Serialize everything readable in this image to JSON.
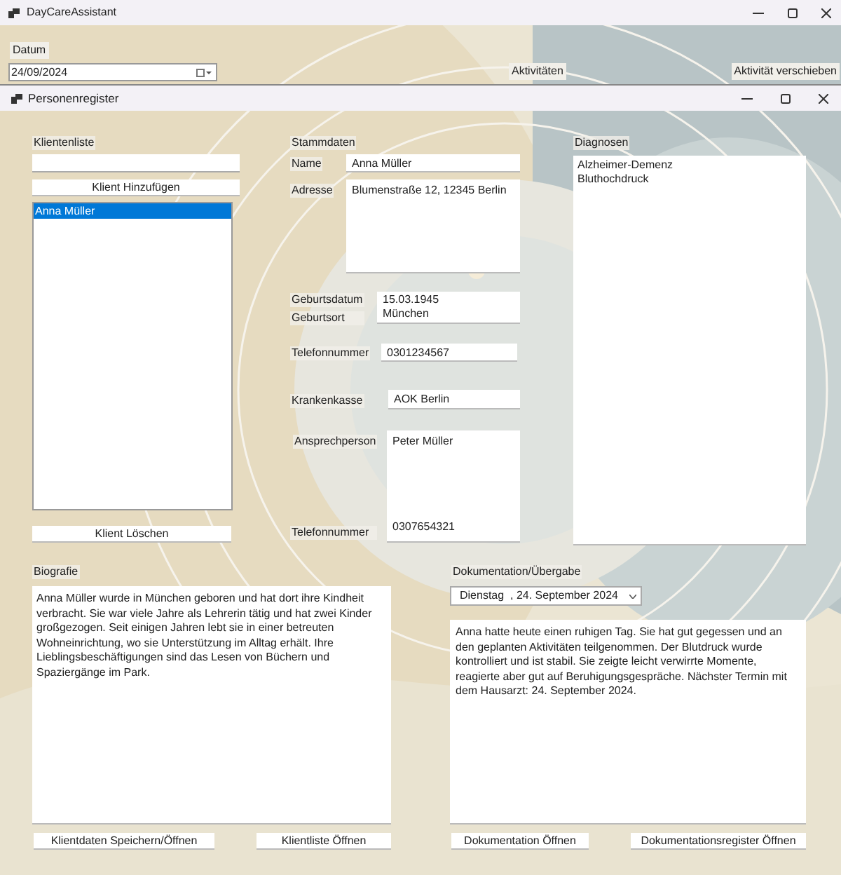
{
  "main_window": {
    "title": "DayCareAssistant"
  },
  "date": {
    "label": "Datum",
    "value": "24/09/2024"
  },
  "toolbar_labels": [
    "Aktivitäten",
    "Aktivität verschieben"
  ],
  "register_window": {
    "title": "Personenregister"
  },
  "client_list": {
    "label": "Klientenliste",
    "add_button": "Klient Hinzufügen",
    "items": [
      {
        "label": "Anna Müller",
        "selected": true
      }
    ],
    "delete_button": "Klient Löschen"
  },
  "master_data": {
    "label": "Stammdaten",
    "name": {
      "label": "Name",
      "value": "Anna Müller"
    },
    "address": {
      "label": "Adresse",
      "value": "Blumenstraße 12, 12345 Berlin"
    },
    "birth": {
      "label_date": "Geburtsdatum",
      "label_place": "Geburtsort",
      "date": "15.03.1945",
      "place": "München"
    },
    "phone": {
      "label": "Telefonnummer",
      "value": "0301234567"
    },
    "insurance": {
      "label": "Krankenkasse",
      "value": "AOK Berlin"
    },
    "contact": {
      "label": "Ansprechperson",
      "value": "Peter Müller",
      "phone_label": "Telefonnummer",
      "phone": "0307654321"
    }
  },
  "diagnoses": {
    "label": "Diagnosen",
    "items": [
      "Alzheimer-Demenz",
      "Bluthochdruck"
    ]
  },
  "biography": {
    "label": "Biografie",
    "text": "Anna Müller wurde in München geboren und hat dort ihre Kindheit verbracht. Sie war viele Jahre als Lehrerin tätig und hat zwei Kinder großgezogen. Seit einigen Jahren lebt sie in einer betreuten Wohneinrichtung, wo sie Unterstützung im Alltag erhält. Ihre Lieblingsbeschäftigungen sind das Lesen von Büchern und Spaziergänge im Park.",
    "buttons": [
      "Klientdaten Speichern/Öffnen",
      "Klientliste Öffnen"
    ]
  },
  "documentation": {
    "label": "Dokumentation/Übergabe",
    "date": "Dienstag  , 24. September 2024",
    "text": "Anna hatte heute einen ruhigen Tag. Sie hat gut gegessen und an den geplanten Aktivitäten teilgenommen. Der Blutdruck wurde kontrolliert und ist stabil. Sie zeigte leicht verwirrte Momente, reagierte aber gut auf Beruhigungsgespräche. Nächster Termin mit dem Hausarzt: 24. September 2024.",
    "buttons": [
      "Dokumentation Öffnen",
      "Dokumentationsregister Öffnen"
    ]
  }
}
